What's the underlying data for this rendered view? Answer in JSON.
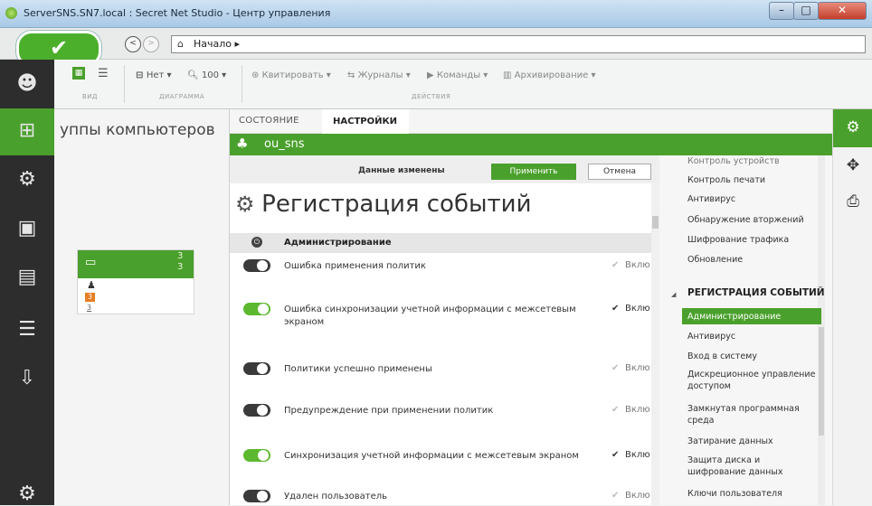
{
  "window": {
    "title": "ServerSNS.SN7.local : Secret Net Studio - Центр управления",
    "min": "–",
    "max": "□",
    "close": "✕"
  },
  "nav": {
    "ok_icon": "✔",
    "back": "<",
    "forward": ">",
    "up": "^",
    "breadcrumb": "Начало ▸"
  },
  "ribbon": {
    "view_caption": "ВИД",
    "diagram_caption": "ДИАГРАММА",
    "actions_caption": "ДЕЙСТВИЯ",
    "diagram_none": "Нет ▾",
    "zoom": "100 ▾",
    "acknowledge": "Квитировать ▾",
    "journals": "Журналы ▾",
    "commands": "Команды ▾",
    "archiving": "Архивирование ▾"
  },
  "groups_panel": {
    "title": "уппы компьютеров",
    "count_top": "3",
    "count_bottom": "3",
    "badge": "3",
    "link": "3"
  },
  "tabs": {
    "state": "СОСТОЯНИЕ",
    "settings": "НАСТРОЙКИ"
  },
  "ou": {
    "name": "ou_sns"
  },
  "notify": {
    "message": "Данные изменены",
    "apply": "Применить",
    "cancel": "Отмена"
  },
  "page": {
    "title": "Регистрация событий",
    "section": "Администрирование",
    "rows": [
      {
        "text": "Ошибка применения политик",
        "on": false,
        "checked": false,
        "label": "Вклю"
      },
      {
        "text": "Ошибка синхронизации учетной информации с межсетевым экраном",
        "on": true,
        "checked": true,
        "label": "Вклю"
      },
      {
        "text": "Политики успешно применены",
        "on": false,
        "checked": false,
        "label": "Вклю"
      },
      {
        "text": "Предупреждение при применении политик",
        "on": false,
        "checked": false,
        "label": "Вклю"
      },
      {
        "text": "Синхронизация учетной информации с межсетевым экраном",
        "on": true,
        "checked": true,
        "label": "Вклю"
      },
      {
        "text": "Удален пользователь",
        "on": false,
        "checked": false,
        "label": "Вклю"
      }
    ]
  },
  "right_nav": {
    "items_top": [
      "Контроль устройств",
      "Контроль печати",
      "Антивирус",
      "Обнаружение вторжений",
      "Шифрование трафика",
      "Обновление"
    ],
    "section": "РЕГИСТРАЦИЯ СОБЫТИЙ",
    "items_bottom": [
      "Администрирование",
      "Антивирус",
      "Вход в систему",
      "Дискреционное управление доступом",
      "Замкнутая программная среда",
      "Затирание данных",
      "Защита диска и шифрование данных",
      "Ключи пользователя"
    ]
  }
}
